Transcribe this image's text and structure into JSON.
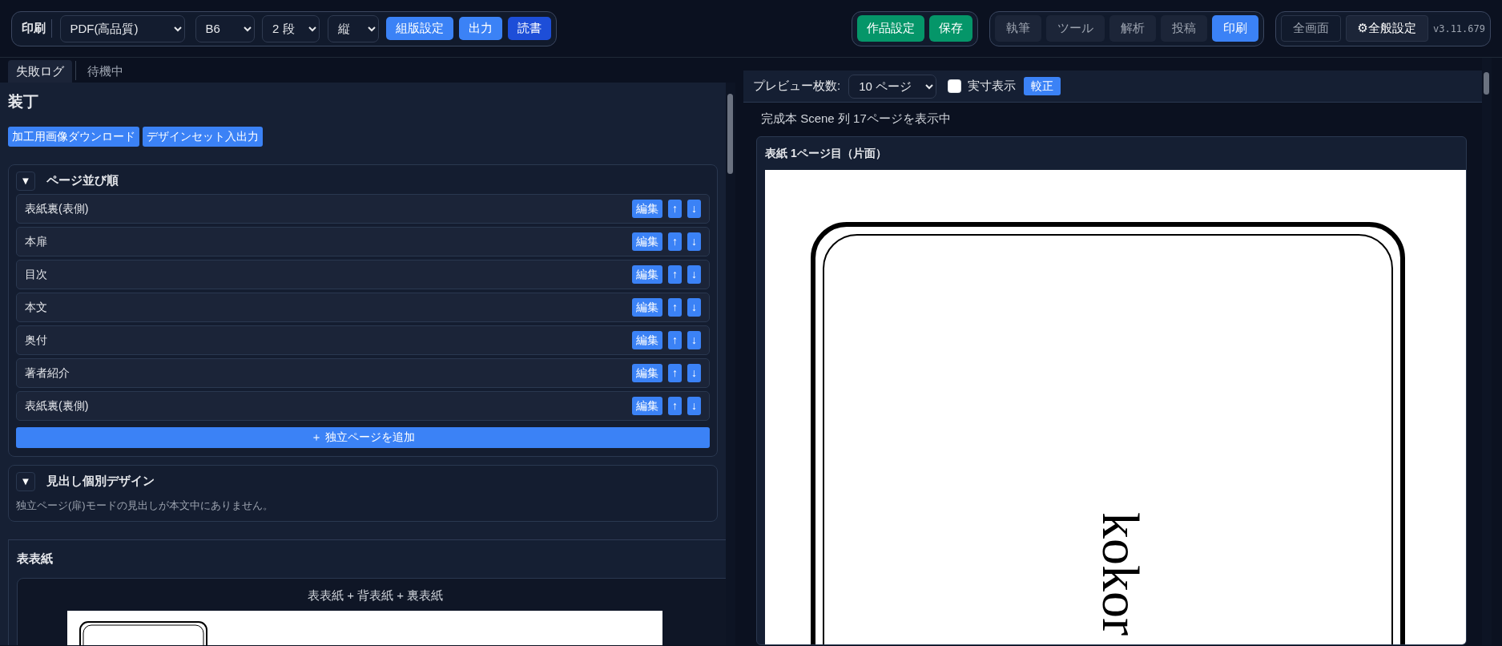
{
  "toolbar": {
    "label": "印刷",
    "format_select": "PDF(高品質)",
    "size_select": "B6",
    "columns_select": "2 段",
    "direction_select": "縦",
    "buttons": [
      {
        "label": "組版設定",
        "kind": "primary"
      },
      {
        "label": "出力",
        "kind": "primary"
      },
      {
        "label": "読書",
        "kind": "dark"
      }
    ],
    "work_buttons": [
      "作品設定",
      "保存"
    ],
    "tabs": [
      {
        "label": "執筆",
        "selected": false
      },
      {
        "label": "ツール",
        "selected": false
      },
      {
        "label": "解析",
        "selected": false
      },
      {
        "label": "投稿",
        "selected": false
      },
      {
        "label": "印刷",
        "selected": true
      }
    ],
    "view_buttons": [
      {
        "label": "全画面",
        "kind": "plain"
      },
      {
        "label": "⚙全般設定",
        "kind": "bright"
      }
    ],
    "version": "v3.11.679"
  },
  "log_tabs": [
    {
      "label": "失敗ログ",
      "selected": true
    },
    {
      "label": "待機中",
      "selected": false
    }
  ],
  "binding": {
    "title": "装丁",
    "actions": [
      "加工用画像ダウンロード",
      "デザインセット入出力"
    ],
    "page_order": {
      "toggle": "▼",
      "title": "ページ並び順",
      "rows": [
        {
          "label": "表紙裏(表側)",
          "edit": "編集",
          "up": "↑",
          "down": "↓"
        },
        {
          "label": "本扉",
          "edit": "編集",
          "up": "↑",
          "down": "↓"
        },
        {
          "label": "目次",
          "edit": "編集",
          "up": "↑",
          "down": "↓"
        },
        {
          "label": "本文",
          "edit": "編集",
          "up": "↑",
          "down": "↓"
        },
        {
          "label": "奥付",
          "edit": "編集",
          "up": "↑",
          "down": "↓"
        },
        {
          "label": "著者紹介",
          "edit": "編集",
          "up": "↑",
          "down": "↓"
        },
        {
          "label": "表紙裏(裏側)",
          "edit": "編集",
          "up": "↑",
          "down": "↓"
        }
      ],
      "add_button": "＋ 独立ページを追加"
    },
    "heading_design": {
      "toggle": "▼",
      "title": "見出し個別デザイン",
      "note": "独立ページ(扉)モードの見出しが本文中にありません。"
    },
    "cover": {
      "title": "表表紙",
      "preview_caption": "表表紙 + 背表紙 + 裏表紙"
    }
  },
  "preview": {
    "count_label": "プレビュー枚数:",
    "count_select": "10 ページ",
    "actual_size_label": "実寸表示",
    "actual_size_checked": false,
    "proof_button": "較正",
    "status": "完成本 Scene 列 17ページを表示中",
    "page_title": "表紙 1ページ目（片面）",
    "page_text": "kokor"
  }
}
